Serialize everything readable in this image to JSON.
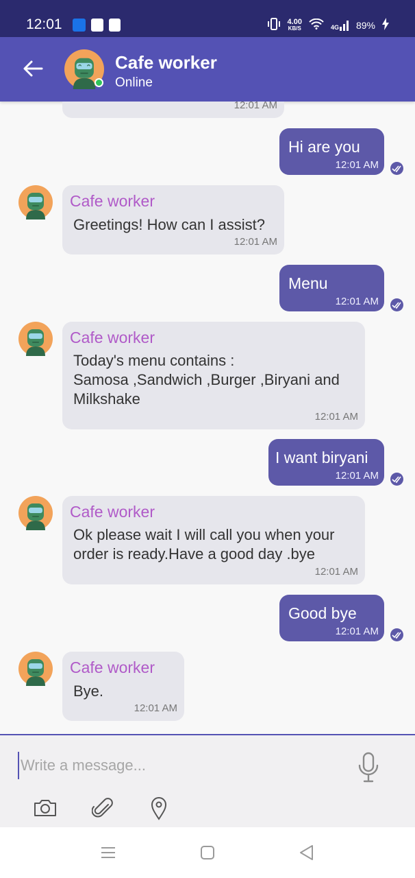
{
  "status_bar": {
    "time": "12:01",
    "speed_value": "4.00",
    "speed_unit": "KB/S",
    "network": "4G",
    "battery": "89%"
  },
  "header": {
    "name": "Cafe worker",
    "status": "Online",
    "accent": "#5452b4"
  },
  "messages": [
    {
      "dir": "in",
      "time": "12:01 AM"
    },
    {
      "dir": "out",
      "text": "Hi are you",
      "time": "12:01 AM"
    },
    {
      "dir": "in",
      "sender": "Cafe worker",
      "text": "Greetings! How can I assist?",
      "time": "12:01 AM"
    },
    {
      "dir": "out",
      "text": "Menu",
      "time": "12:01 AM"
    },
    {
      "dir": "in",
      "sender": "Cafe worker",
      "text": "Today's menu contains :\nSamosa ,Sandwich ,Burger ,Biryani and\nMilkshake",
      "time": "12:01 AM"
    },
    {
      "dir": "out",
      "text": "I want biryani",
      "time": "12:01 AM"
    },
    {
      "dir": "in",
      "sender": "Cafe worker",
      "text": "Ok please wait I will call you when your\norder is ready.Have a good day .bye",
      "time": "12:01 AM"
    },
    {
      "dir": "out",
      "text": "Good bye",
      "time": "12:01 AM"
    },
    {
      "dir": "in",
      "sender": "Cafe worker",
      "text": "Bye.",
      "time": "12:01 AM"
    }
  ],
  "composer": {
    "placeholder": "Write a message...",
    "tools": [
      "camera-icon",
      "paperclip-icon",
      "location-pin-icon"
    ]
  }
}
